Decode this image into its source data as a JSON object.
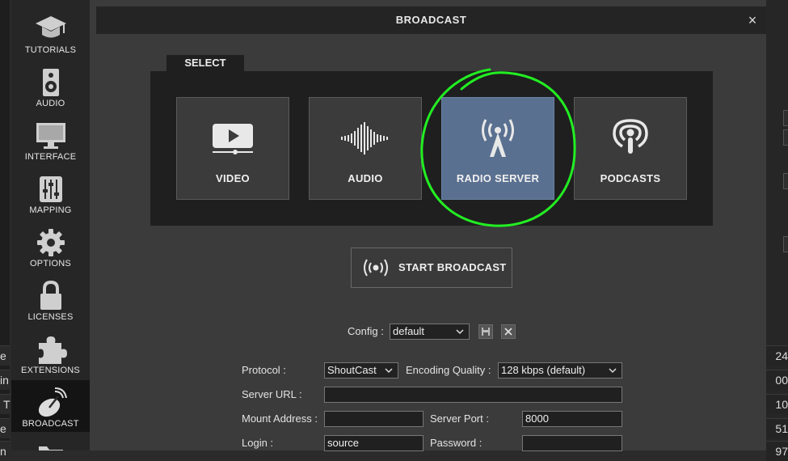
{
  "background": {
    "left_fragments": [
      "e",
      "in",
      "T",
      "e",
      "n"
    ],
    "right_fragments": [
      "24",
      "00",
      "10",
      "51",
      "97"
    ]
  },
  "sidebar": {
    "items": [
      {
        "label": "TUTORIALS",
        "icon": "graduation-cap-icon"
      },
      {
        "label": "AUDIO",
        "icon": "speaker-icon"
      },
      {
        "label": "INTERFACE",
        "icon": "monitor-icon"
      },
      {
        "label": "MAPPING",
        "icon": "sliders-icon"
      },
      {
        "label": "OPTIONS",
        "icon": "gear-icon"
      },
      {
        "label": "LICENSES",
        "icon": "lock-icon"
      },
      {
        "label": "EXTENSIONS",
        "icon": "puzzle-icon"
      },
      {
        "label": "BROADCAST",
        "icon": "satellite-dish-icon",
        "active": true
      }
    ]
  },
  "dialog": {
    "title": "BROADCAST",
    "close_symbol": "×",
    "select_tab": "SELECT",
    "options": [
      {
        "label": "VIDEO",
        "icon": "video-play-icon"
      },
      {
        "label": "AUDIO",
        "icon": "waveform-icon"
      },
      {
        "label": "RADIO SERVER",
        "icon": "radio-tower-icon",
        "selected": true
      },
      {
        "label": "PODCASTS",
        "icon": "podcast-icon"
      }
    ],
    "start_button": "START BROADCAST",
    "config": {
      "label": "Config :",
      "value": "default"
    },
    "form": {
      "protocol_label": "Protocol :",
      "protocol_value": "ShoutCast",
      "quality_label": "Encoding Quality :",
      "quality_value": "128 kbps (default)",
      "server_url_label": "Server URL :",
      "server_url_value": "",
      "mount_label": "Mount Address :",
      "mount_value": "",
      "port_label": "Server Port :",
      "port_value": "8000",
      "login_label": "Login :",
      "login_value": "source",
      "password_label": "Password :",
      "password_value": ""
    }
  },
  "colors": {
    "selected_tile": "#5a7090",
    "annotation": "#22ee22"
  }
}
